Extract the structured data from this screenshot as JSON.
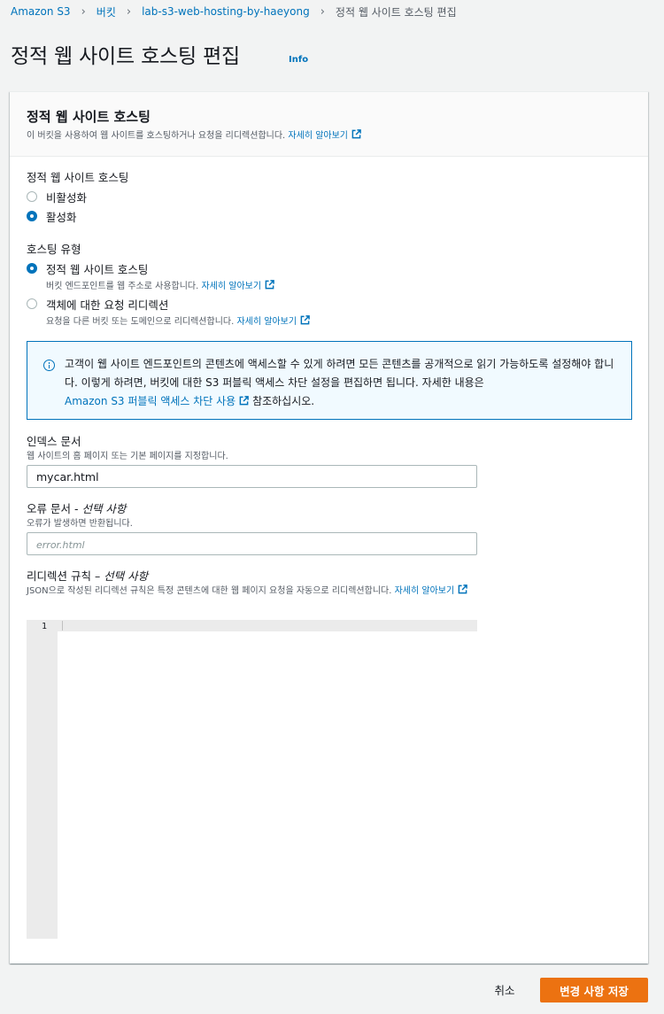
{
  "breadcrumb": {
    "items": [
      "Amazon S3",
      "버킷",
      "lab-s3-web-hosting-by-haeyong"
    ],
    "current": "정적 웹 사이트 호스팅 편집"
  },
  "page": {
    "title": "정적 웹 사이트 호스팅 편집",
    "info": "Info"
  },
  "panel": {
    "title": "정적 웹 사이트 호스팅",
    "description": "이 버킷을 사용하여 웹 사이트를 호스팅하거나 요청을 리디렉션합니다.",
    "learn_more": "자세히 알아보기"
  },
  "hosting_toggle": {
    "label": "정적 웹 사이트 호스팅",
    "options": [
      {
        "label": "비활성화",
        "checked": false
      },
      {
        "label": "활성화",
        "checked": true
      }
    ]
  },
  "hosting_type": {
    "label": "호스팅 유형",
    "options": [
      {
        "label": "정적 웹 사이트 호스팅",
        "description": "버킷 엔드포인트를 웹 주소로 사용합니다.",
        "learn_more": "자세히 알아보기",
        "checked": true
      },
      {
        "label": "객체에 대한 요청 리디렉션",
        "description": "요청을 다른 버킷 또는 도메인으로 리디렉션합니다.",
        "learn_more": "자세히 알아보기",
        "checked": false
      }
    ]
  },
  "alert": {
    "text_line1": "고객이 웹 사이트 엔드포인트의 콘텐츠에 액세스할 수 있게 하려면 모든 콘텐츠를 공개적으로 읽기 가능하도록 설정해야 합니다. 이렇게 하려면, 버킷에 대한 S3 퍼블릭 액세스 차단 설정을 편집하면 됩니다. 자세한 내용은",
    "link": "Amazon S3 퍼블릭 액세스 차단 사용",
    "text_end": "참조하십시오."
  },
  "index_document": {
    "label": "인덱스 문서",
    "description": "웹 사이트의 홈 페이지 또는 기본 페이지를 지정합니다.",
    "value": "mycar.html"
  },
  "error_document": {
    "label": "오류 문서 - ",
    "label_optional": "선택 사항",
    "description": "오류가 발생하면 반환됩니다.",
    "placeholder": "error.html"
  },
  "redirection_rules": {
    "label": "리디렉션 규칙 – ",
    "label_optional": "선택 사항",
    "description": "JSON으로 작성된 리디렉션 규칙은 특정 콘텐츠에 대한 웹 페이지 요청을 자동으로 리디렉션합니다.",
    "learn_more": "자세히 알아보기",
    "line_number": "1"
  },
  "footer": {
    "cancel": "취소",
    "save": "변경 사항 저장"
  },
  "colors": {
    "link": "#0073bb",
    "primary_button": "#ec7211",
    "alert_bg": "#f1faff"
  }
}
